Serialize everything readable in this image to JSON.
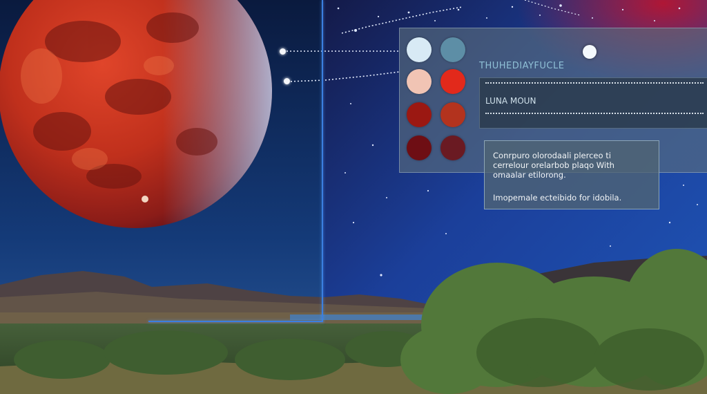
{
  "palette": {
    "title": "THUHEDIAYFUCLE",
    "field_label": "LUNA MOUN",
    "swatches": [
      "#d8eaf5",
      "#5d8ea6",
      "#f1c4b4",
      "#e2291b",
      "#9b1812",
      "#b3331e",
      "#6e0e14",
      "#6a1a22"
    ]
  },
  "info": {
    "line1": "Conrpuro olorodaali plerceo ti",
    "line2": "cerrelour orelarbob plaqo With",
    "line3": "omaalar etilorong.",
    "line4": "Imopemale ecteibido for idobila."
  },
  "colors": {
    "accent": "#3b7fe0",
    "moon": "#c8321e",
    "sky": "#0a1a4a"
  }
}
